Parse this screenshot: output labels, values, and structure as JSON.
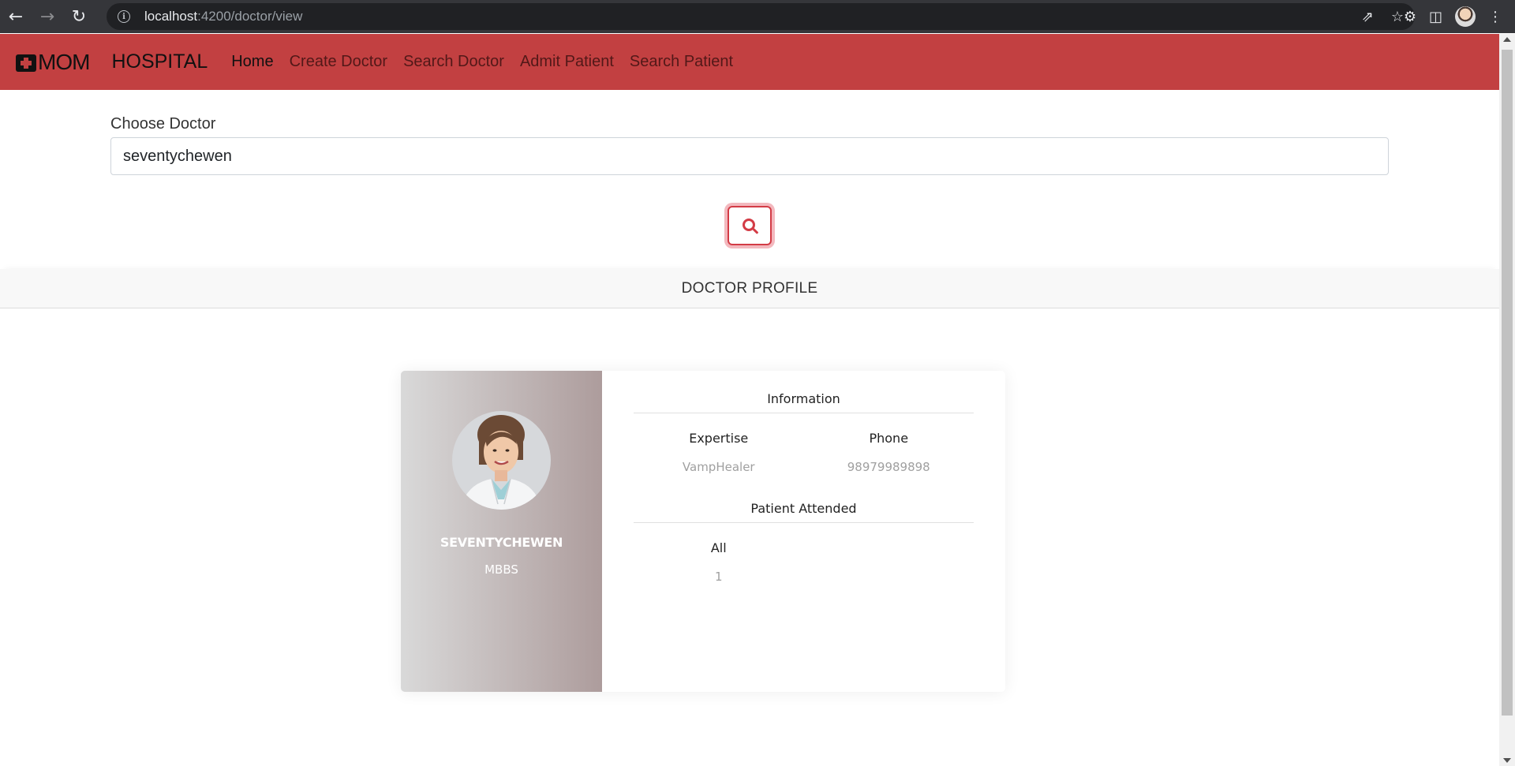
{
  "browser": {
    "url_host": "localhost",
    "url_path": ":4200/doctor/view"
  },
  "navbar": {
    "brand_logo": "MOM",
    "brand_name": "HOSPITAL",
    "links": [
      "Home",
      "Create Doctor",
      "Search Doctor",
      "Admit Patient",
      "Search Patient"
    ],
    "active_index": 0,
    "color": "#c24041"
  },
  "search": {
    "label": "Choose Doctor",
    "value": "seventychewen"
  },
  "section": {
    "title": "DOCTOR PROFILE"
  },
  "profile": {
    "name": "SEVENTYCHEWEN",
    "degree": "MBBS",
    "info_title": "Information",
    "expertise_label": "Expertise",
    "expertise_value": "VampHealer",
    "phone_label": "Phone",
    "phone_value": "98979989898",
    "patients_title": "Patient Attended",
    "all_label": "All",
    "all_value": "1"
  }
}
